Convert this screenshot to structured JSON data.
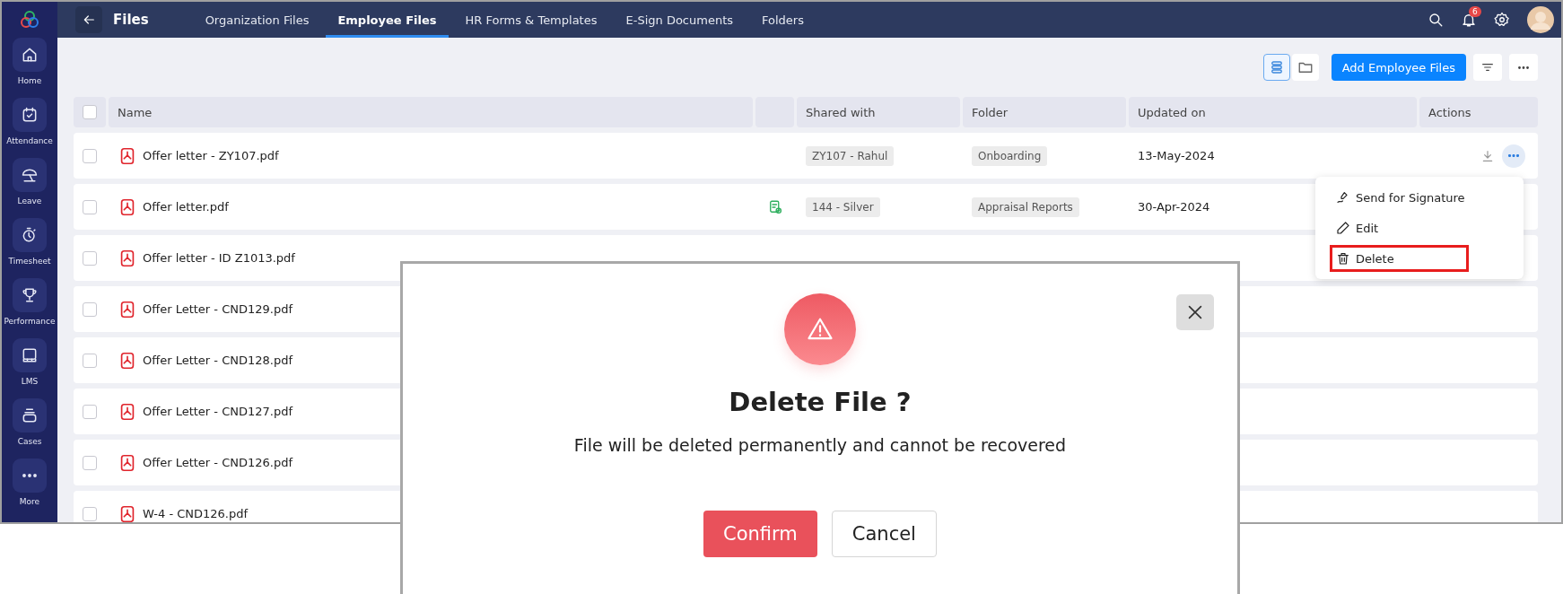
{
  "sidebar": {
    "items": [
      {
        "label": "Home",
        "kind": "home"
      },
      {
        "label": "Attendance",
        "kind": "calendar"
      },
      {
        "label": "Leave",
        "kind": "umbrella"
      },
      {
        "label": "Timesheet",
        "kind": "timer"
      },
      {
        "label": "Performance",
        "kind": "trophy"
      },
      {
        "label": "LMS",
        "kind": "board"
      },
      {
        "label": "Cases",
        "kind": "case"
      },
      {
        "label": "More",
        "kind": "more"
      }
    ]
  },
  "header": {
    "title": "Files",
    "tabs": [
      {
        "label": "Organization Files",
        "selected": false
      },
      {
        "label": "Employee Files",
        "selected": true
      },
      {
        "label": "HR Forms & Templates",
        "selected": false
      },
      {
        "label": "E-Sign Documents",
        "selected": false
      },
      {
        "label": "Folders",
        "selected": false
      }
    ],
    "notification_count": "6"
  },
  "toolbar": {
    "views": [
      {
        "kind": "list",
        "selected": true
      },
      {
        "kind": "folder",
        "selected": false
      }
    ],
    "add_button": "Add Employee Files"
  },
  "table": {
    "select_all_checked": false,
    "columns": [
      "Name",
      "Shared with",
      "Folder",
      "Updated on",
      "Actions"
    ],
    "rows": [
      {
        "name": "Offer letter - ZY107.pdf",
        "checked": false,
        "shared_with": "ZY107 - Rahul",
        "folder": "Onboarding",
        "updated_on": "13-May-2024",
        "signed": false,
        "actions_shown": true
      },
      {
        "name": "Offer letter.pdf",
        "checked": false,
        "shared_with": "144 - Silver",
        "folder": "Appraisal Reports",
        "updated_on": "30-Apr-2024",
        "signed": true,
        "actions_shown": false
      },
      {
        "name": "Offer letter - ID Z1013.pdf",
        "checked": false
      },
      {
        "name": "Offer Letter - CND129.pdf",
        "checked": false
      },
      {
        "name": "Offer Letter - CND128.pdf",
        "checked": false
      },
      {
        "name": "Offer Letter - CND127.pdf",
        "checked": false
      },
      {
        "name": "Offer Letter - CND126.pdf",
        "checked": false
      },
      {
        "name": "W-4 - CND126.pdf",
        "checked": false
      }
    ]
  },
  "row_menu": {
    "items": [
      {
        "label": "Send for Signature",
        "kind": "sign",
        "highlighted": false
      },
      {
        "label": "Edit",
        "kind": "edit",
        "highlighted": false
      },
      {
        "label": "Delete",
        "kind": "delete",
        "highlighted": true
      }
    ]
  },
  "dialog": {
    "title": "Delete File ?",
    "message": "File will be deleted permanently and cannot be recovered",
    "buttons": [
      {
        "label": "Confirm",
        "kind": "primary"
      },
      {
        "label": "Cancel",
        "kind": "secondary"
      }
    ]
  }
}
